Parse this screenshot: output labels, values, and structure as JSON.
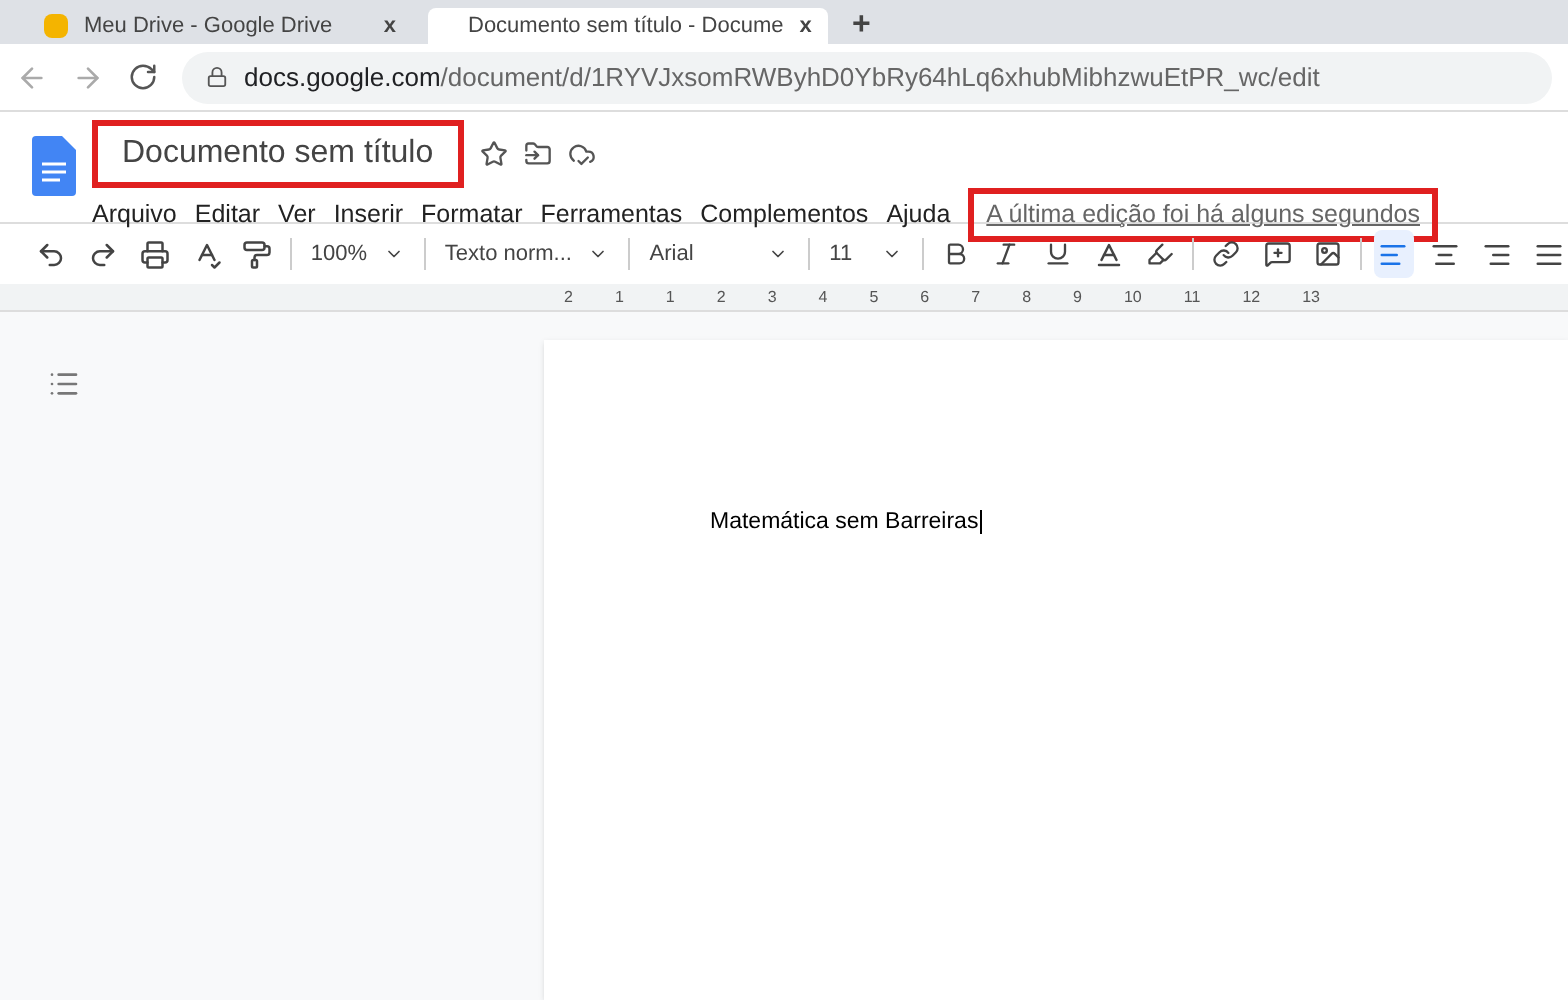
{
  "browser": {
    "tabs": [
      {
        "title": "Meu Drive - Google Drive",
        "selected": false,
        "close": "x"
      },
      {
        "title": "Documento sem título - Docume",
        "selected": true,
        "close": "x"
      }
    ],
    "new_tab": "+",
    "url_host": "docs.google.com",
    "url_path": "/document/d/1RYVJxsomRWByhD0YbRy64hLq6xhubMibhzwuEtPR_wc/edit"
  },
  "doc": {
    "title": "Documento sem título",
    "title_highlighted": true,
    "menu": [
      "Arquivo",
      "Editar",
      "Ver",
      "Inserir",
      "Formatar",
      "Ferramentas",
      "Complementos",
      "Ajuda"
    ],
    "last_edit": "A última edição foi há alguns segundos",
    "last_edit_highlighted": true
  },
  "toolbar": {
    "zoom": "100%",
    "style": "Texto norm...",
    "font": "Arial",
    "size": "11",
    "align": [
      {
        "kind": "left",
        "selected": true
      },
      {
        "kind": "center",
        "selected": false
      },
      {
        "kind": "right",
        "selected": false
      },
      {
        "kind": "justify",
        "selected": false
      }
    ]
  },
  "ruler": [
    "2",
    "1",
    "1",
    "2",
    "3",
    "4",
    "5",
    "6",
    "7",
    "8",
    "9",
    "10",
    "11",
    "12",
    "13"
  ],
  "page": {
    "text": "Matemática sem Barreiras"
  }
}
